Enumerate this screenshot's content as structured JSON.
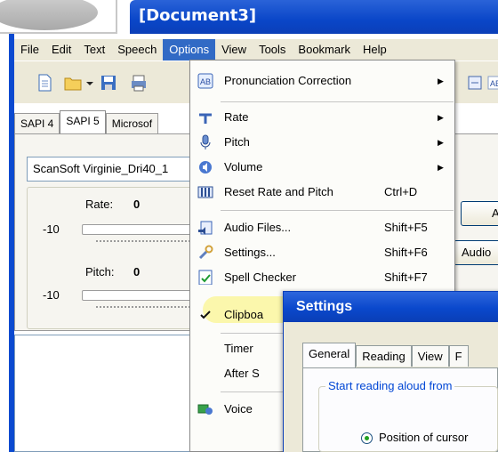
{
  "window": {
    "title": "[Document3]"
  },
  "menubar": [
    "File",
    "Edit",
    "Text",
    "Speech",
    "Options",
    "View",
    "Tools",
    "Bookmark",
    "Help"
  ],
  "tabs": [
    "SAPI 4",
    "SAPI 5",
    "Microsof"
  ],
  "voice": {
    "selected": "ScanSoft Virginie_Dri40_1"
  },
  "sliders": {
    "rate": {
      "label": "Rate:",
      "value": "0",
      "min": "-10"
    },
    "pitch": {
      "label": "Pitch:",
      "value": "0",
      "min": "-10"
    }
  },
  "right_buttons": {
    "top": "Al",
    "bottom": "Audio"
  },
  "options_menu": {
    "items": [
      {
        "label": "Pronunciation Correction",
        "icon": "pronunciation-icon",
        "submenu": true
      },
      {
        "label": "Rate",
        "icon": "rate-icon",
        "submenu": true
      },
      {
        "label": "Pitch",
        "icon": "pitch-icon",
        "submenu": true
      },
      {
        "label": "Volume",
        "icon": "volume-icon",
        "submenu": true
      },
      {
        "label": "Reset Rate and Pitch",
        "shortcut": "Ctrl+D",
        "icon": "reset-icon"
      },
      {
        "label": "Audio Files...",
        "shortcut": "Shift+F5",
        "icon": "audio-files-icon"
      },
      {
        "label": "Settings...",
        "shortcut": "Shift+F6",
        "icon": "settings-icon"
      },
      {
        "label": "Spell Checker",
        "shortcut": "Shift+F7",
        "icon": "spell-check-icon"
      },
      {
        "label": "Clipboa",
        "icon": "check-icon"
      },
      {
        "label": "Timer"
      },
      {
        "label": "After S"
      },
      {
        "label": "Voice",
        "icon": "voice-icon"
      }
    ]
  },
  "settings_dialog": {
    "title": "Settings",
    "tabs": [
      "General",
      "Reading",
      "View",
      "F"
    ],
    "group_label": "Start reading aloud from",
    "radio_label": "Position of cursor"
  },
  "colors": {
    "title_blue": "#0a46c8",
    "menu_highlight": "#316ac5",
    "yellow_highlight": "#fbf7a8"
  }
}
